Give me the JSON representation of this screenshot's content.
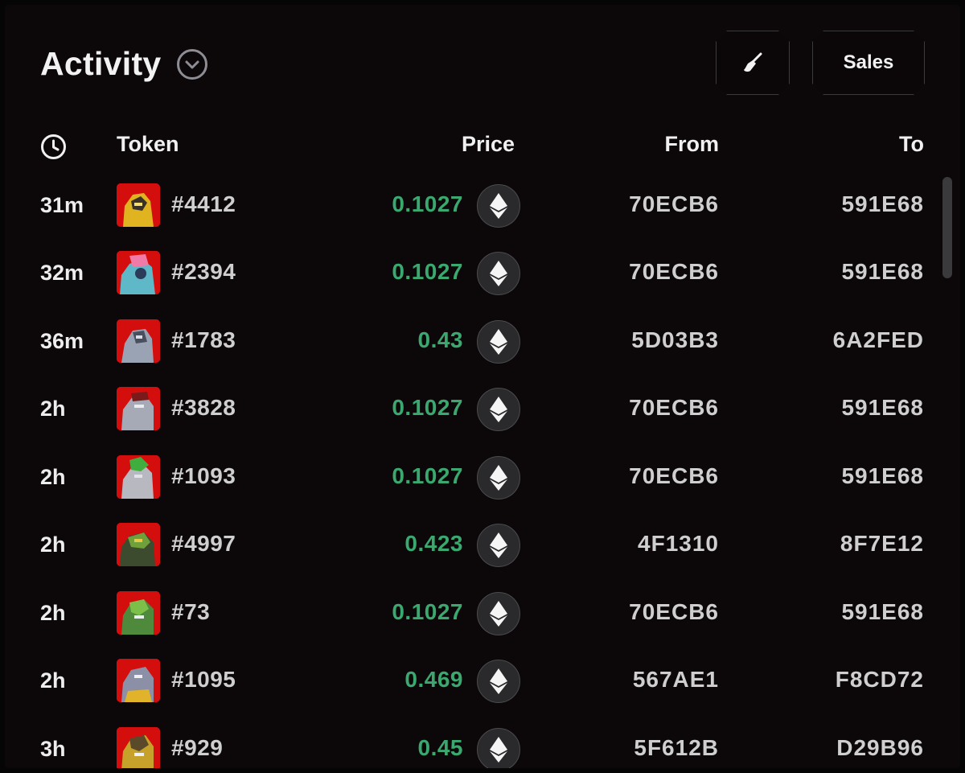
{
  "header": {
    "title": "Activity",
    "dropdown_icon": "chevron-down-circle-icon",
    "broom_icon": "broom-icon",
    "sales_label": "Sales"
  },
  "columns": {
    "time_icon": "clock-icon",
    "token": "Token",
    "price": "Price",
    "from": "From",
    "to": "To"
  },
  "colors": {
    "background": "#0c0809",
    "price_green": "#3aa86f",
    "thumb_red": "#d40d0d"
  },
  "rows": [
    {
      "time": "31m",
      "token": "#4412",
      "price": "0.1027",
      "currency_icon": "eth-icon",
      "from": "70ECB6",
      "to": "591E68"
    },
    {
      "time": "32m",
      "token": "#2394",
      "price": "0.1027",
      "currency_icon": "eth-icon",
      "from": "70ECB6",
      "to": "591E68"
    },
    {
      "time": "36m",
      "token": "#1783",
      "price": "0.43",
      "currency_icon": "eth-icon",
      "from": "5D03B3",
      "to": "6A2FED"
    },
    {
      "time": "2h",
      "token": "#3828",
      "price": "0.1027",
      "currency_icon": "eth-icon",
      "from": "70ECB6",
      "to": "591E68"
    },
    {
      "time": "2h",
      "token": "#1093",
      "price": "0.1027",
      "currency_icon": "eth-icon",
      "from": "70ECB6",
      "to": "591E68"
    },
    {
      "time": "2h",
      "token": "#4997",
      "price": "0.423",
      "currency_icon": "eth-icon",
      "from": "4F1310",
      "to": "8F7E12"
    },
    {
      "time": "2h",
      "token": "#73",
      "price": "0.1027",
      "currency_icon": "eth-icon",
      "from": "70ECB6",
      "to": "591E68"
    },
    {
      "time": "2h",
      "token": "#1095",
      "price": "0.469",
      "currency_icon": "eth-icon",
      "from": "567AE1",
      "to": "F8CD72"
    },
    {
      "time": "3h",
      "token": "#929",
      "price": "0.45",
      "currency_icon": "eth-icon",
      "from": "5F612B",
      "to": "D29B96"
    }
  ]
}
